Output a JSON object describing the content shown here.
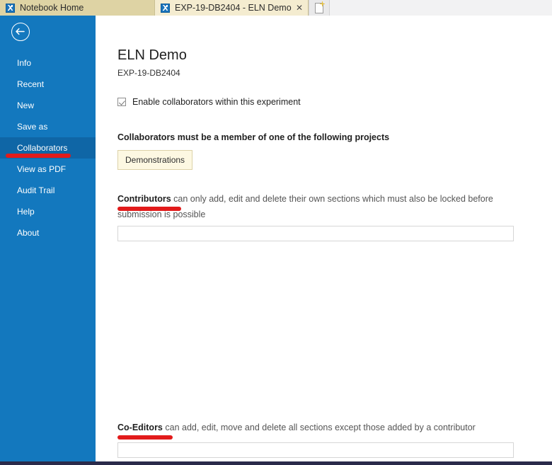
{
  "browser": {
    "tabs": [
      {
        "title": "Notebook Home",
        "icon": "notebook-icon",
        "active": false,
        "closable": false
      },
      {
        "title": "EXP-19-DB2404 - ELN Demo",
        "icon": "notebook-icon",
        "active": true,
        "closable": true,
        "close_label": "✕"
      }
    ],
    "new_tab": {
      "name": "new-tab-button",
      "icon": "new-page-icon"
    }
  },
  "sidebar": {
    "back_button_label": "Back",
    "background_color": "#1378be",
    "active_background_color": "#0f66a6",
    "items": [
      {
        "label": "Info",
        "active": false
      },
      {
        "label": "Recent",
        "active": false
      },
      {
        "label": "New",
        "active": false
      },
      {
        "label": "Save as",
        "active": false
      },
      {
        "label": "Collaborators",
        "active": true,
        "highlight_color": "#e21b1b"
      },
      {
        "label": "View as PDF",
        "active": false
      },
      {
        "label": "Audit Trail",
        "active": false
      },
      {
        "label": "Help",
        "active": false
      },
      {
        "label": "About",
        "active": false
      }
    ]
  },
  "main": {
    "title": "ELN Demo",
    "experiment_code": "EXP-19-DB2404",
    "enable_collaborators": {
      "label": "Enable collaborators within this experiment",
      "checked": true
    },
    "projects": {
      "heading": "Collaborators must be a member of one of the following projects",
      "tags": [
        {
          "label": "Demonstrations",
          "background": "#fdf8e2",
          "border": "#ddd2a8"
        }
      ]
    },
    "roles": [
      {
        "name": "Contributors",
        "description": " can only add, edit and delete their own sections which must also be locked before submission is possible",
        "underline_color": "#e21b1b",
        "input_value": "",
        "input_placeholder": ""
      },
      {
        "name": "Co-Editors",
        "description": " can add, edit, move and delete all sections except those added by a contributor",
        "underline_color": "#e21b1b",
        "input_value": "",
        "input_placeholder": ""
      }
    ]
  }
}
